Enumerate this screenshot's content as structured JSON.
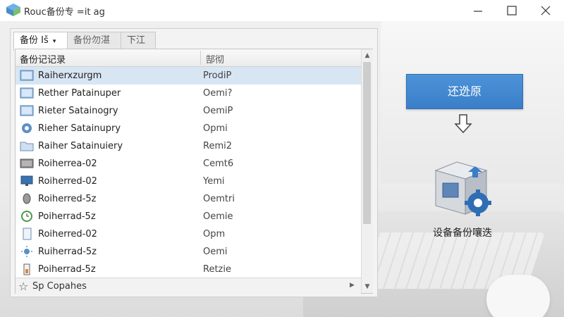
{
  "window": {
    "title": "Rouc备份专 =it ag",
    "minimize_icon": "minimize-icon",
    "maximize_icon": "maximize-icon",
    "close_icon": "close-icon"
  },
  "tabs": [
    {
      "label": "备份 Iš",
      "active": true,
      "has_dropdown": true
    },
    {
      "label": "备份勿湛",
      "active": false
    },
    {
      "label": "下江",
      "active": false
    }
  ],
  "list": {
    "columns": {
      "name": "备份记记录",
      "type": "郜彻"
    },
    "rows": [
      {
        "name": "Raiherxzurgm",
        "type": "ProdiP",
        "icon": "folder-icon",
        "selected": true
      },
      {
        "name": "Rether Patainuper",
        "type": "Oemi?",
        "icon": "folder-icon",
        "selected": false
      },
      {
        "name": "Rieter Satainogry",
        "type": "OemiP",
        "icon": "folder-icon",
        "selected": false
      },
      {
        "name": "Rieher Satainupry",
        "type": "Opmi",
        "icon": "gear-icon",
        "selected": false
      },
      {
        "name": "Raiher Satainuiery",
        "type": "Remi2",
        "icon": "folder-open-icon",
        "selected": false
      },
      {
        "name": "Roiherrea-02",
        "type": "Cemt6",
        "icon": "drive-icon",
        "selected": false
      },
      {
        "name": "Roiherred-02",
        "type": "Yemi",
        "icon": "monitor-icon",
        "selected": false
      },
      {
        "name": "Roiherred-5z",
        "type": "Oemtri",
        "icon": "mouse-icon",
        "selected": false
      },
      {
        "name": "Poiherrad-5z",
        "type": "Oemie",
        "icon": "clock-icon",
        "selected": false
      },
      {
        "name": "Roiherred-02",
        "type": "Opm",
        "icon": "document-icon",
        "selected": false
      },
      {
        "name": "Ruiherrad-5z",
        "type": "Oemi",
        "icon": "sun-icon",
        "selected": false
      },
      {
        "name": "Poiherrad-5z",
        "type": "Retzie",
        "icon": "battery-icon",
        "selected": false
      }
    ]
  },
  "statusbar": {
    "text": "Sp Copahes",
    "icon": "star-icon"
  },
  "actions": {
    "restore_label": "还迯原",
    "arrow_icon": "arrow-down-icon",
    "device_icon": "backup-device-icon",
    "device_label": "设备备份嚷迭"
  },
  "colors": {
    "accent": "#3f84cf",
    "selection": "#d8e6f4"
  }
}
